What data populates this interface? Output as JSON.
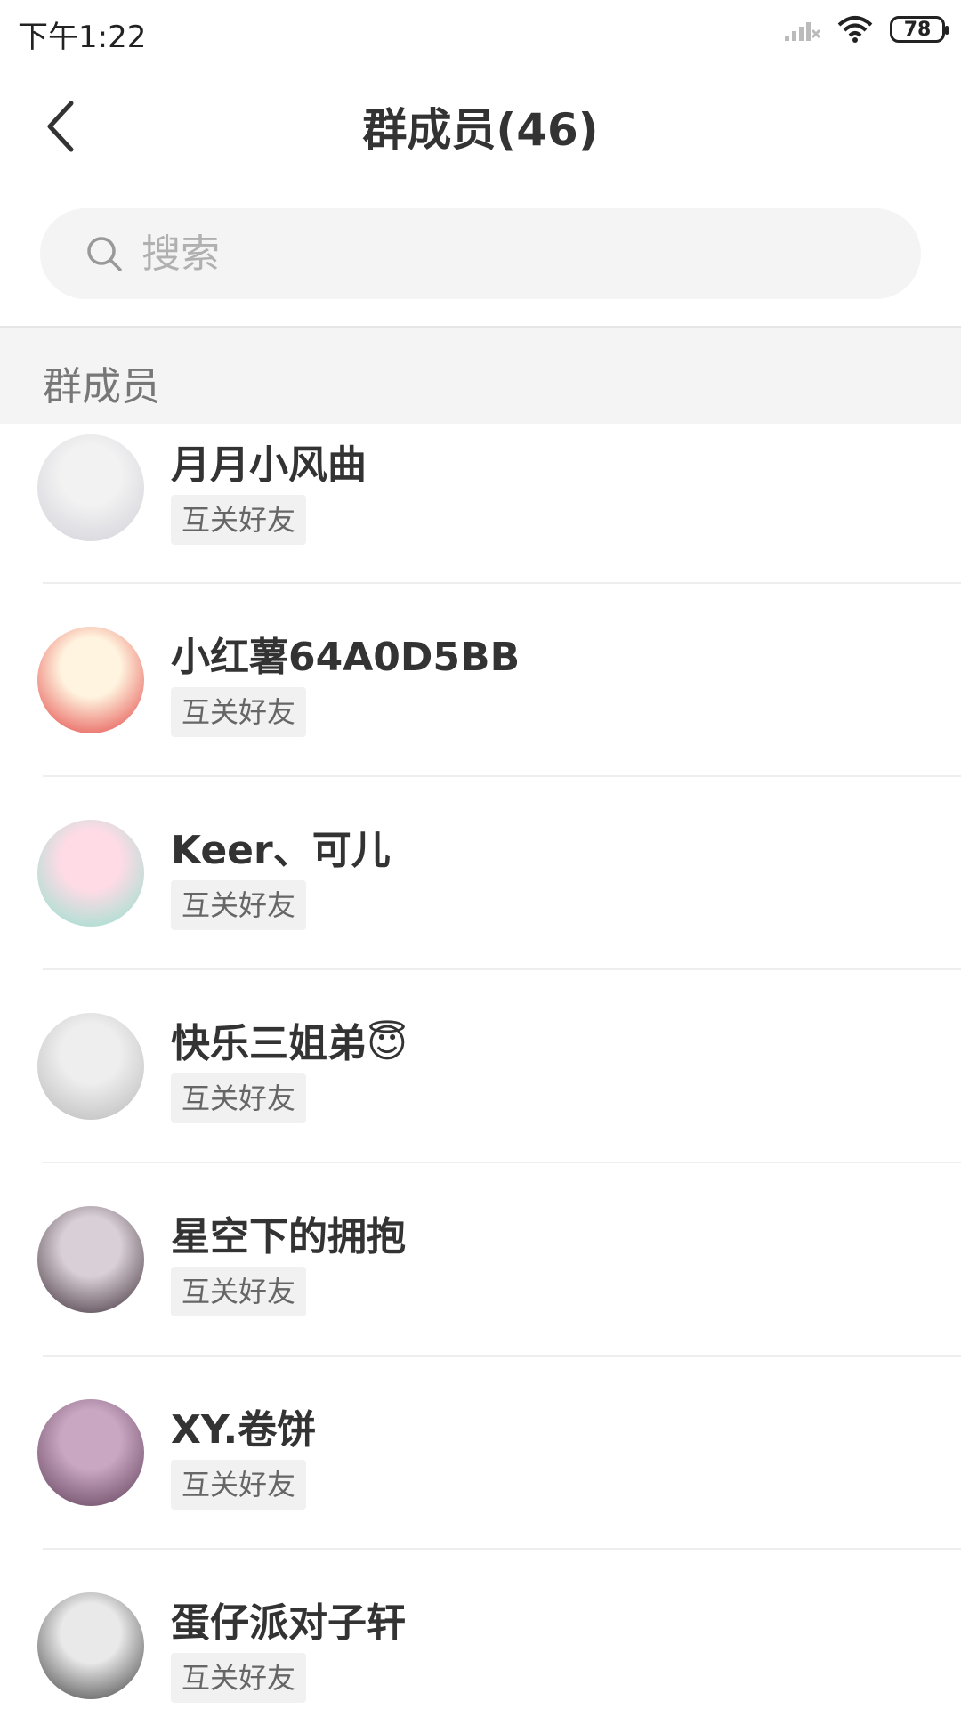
{
  "status_bar": {
    "time": "下午1:22",
    "battery": "78"
  },
  "header": {
    "title": "群成员(46)"
  },
  "search": {
    "placeholder": "搜索"
  },
  "section": {
    "title": "群成员"
  },
  "members": [
    {
      "name": "月月小风曲",
      "tag": "互关好友",
      "avatar_colors": [
        "#f2f2f2",
        "#cfcfd8"
      ]
    },
    {
      "name": "小红薯64A0D5BB",
      "tag": "互关好友",
      "avatar_colors": [
        "#fff4df",
        "#e23b3b"
      ]
    },
    {
      "name": "Keer、可儿",
      "tag": "互关好友",
      "avatar_colors": [
        "#ffdbe6",
        "#8fe0cc"
      ]
    },
    {
      "name": "快乐三姐弟😇",
      "tag": "互关好友",
      "avatar_colors": [
        "#eeeeee",
        "#b7b7b7"
      ]
    },
    {
      "name": "星空下的拥抱",
      "tag": "互关好友",
      "avatar_colors": [
        "#d9cfd6",
        "#3a2a35"
      ]
    },
    {
      "name": "XY.卷饼",
      "tag": "互关好友",
      "avatar_colors": [
        "#c9a7c2",
        "#5c3b55"
      ]
    },
    {
      "name": "蛋仔派对子轩",
      "tag": "互关好友",
      "avatar_colors": [
        "#e9e9e9",
        "#3b3b3b"
      ]
    }
  ]
}
